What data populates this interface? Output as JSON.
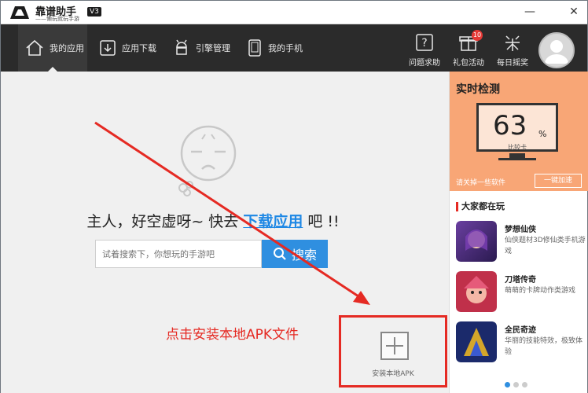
{
  "titlebar": {
    "brand": "靠谱助手",
    "tagline": "——懒玩就玩手游",
    "version": "V3",
    "minimize": "—",
    "close": "✕"
  },
  "nav": {
    "items": [
      {
        "label": "我的应用",
        "icon": "home-icon",
        "active": true
      },
      {
        "label": "应用下载",
        "icon": "download-icon",
        "active": false
      },
      {
        "label": "引擎管理",
        "icon": "android-icon",
        "active": false
      },
      {
        "label": "我的手机",
        "icon": "phone-icon",
        "active": false
      }
    ],
    "tools": [
      {
        "label": "问题求助",
        "icon": "help-icon"
      },
      {
        "label": "礼包活动",
        "icon": "gift-icon",
        "badge": "10"
      },
      {
        "label": "每日摇奖",
        "icon": "lottery-icon"
      }
    ]
  },
  "main": {
    "empty_prefix": "主人，好空虚呀~ 快去",
    "empty_link": "下载应用",
    "empty_suffix": "吧 !!",
    "search_placeholder": "试着搜索下，你想玩的手游吧",
    "search_button": "搜索",
    "callout": "点击安装本地APK文件",
    "install_label": "安装本地APK"
  },
  "right": {
    "monitor_title": "实时检测",
    "score": "63",
    "score_unit": "%",
    "score_sub": "比较卡",
    "speed_hint": "请关掉一些软件",
    "speed_button": "一键加速",
    "popular_title": "大家都在玩",
    "games": [
      {
        "name": "梦想仙侠",
        "desc": "仙侠题材3D修仙类手机游戏"
      },
      {
        "name": "刀塔传奇",
        "desc": "萌萌的卡牌动作类游戏"
      },
      {
        "name": "全民奇迹",
        "desc": "华丽的技能特效，极致体验"
      }
    ]
  },
  "colors": {
    "nav_bg": "#2b2b2b",
    "accent_blue": "#2f8fe0",
    "accent_red": "#e52a23",
    "monitor_orange": "#f8a676"
  }
}
